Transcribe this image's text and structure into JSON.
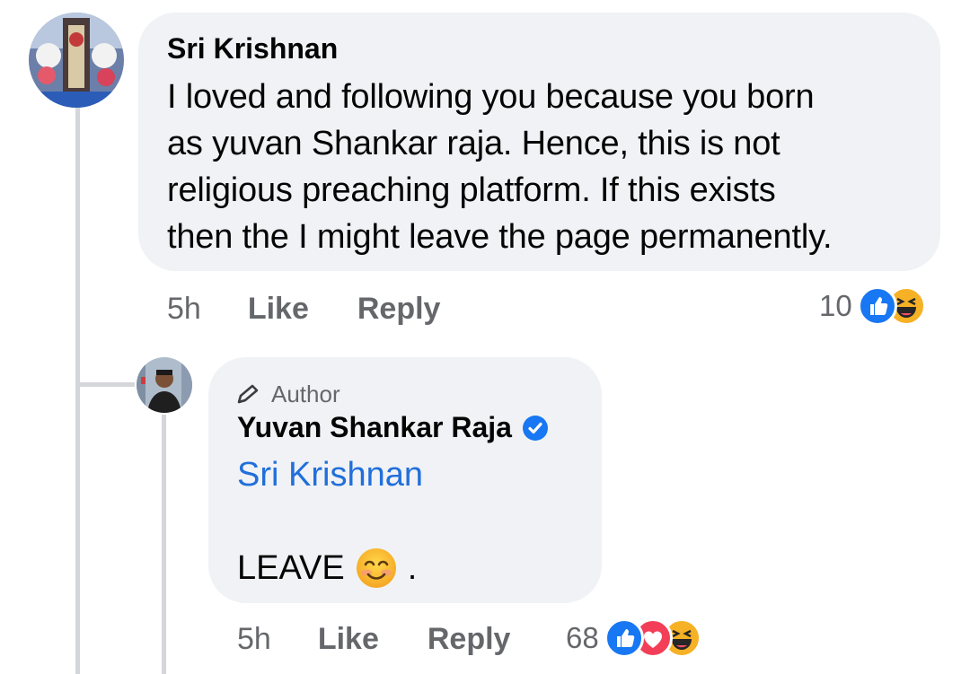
{
  "comment": {
    "author": "Sri Krishnan",
    "text_lines": [
      "I loved and following you because you born",
      "as yuvan Shankar raja. Hence, this is not",
      "religious preaching platform. If this exists",
      "then the I might leave the page permanently."
    ],
    "time": "5h",
    "like_label": "Like",
    "reply_label": "Reply",
    "reaction_count": "10",
    "reactions": [
      "like-icon",
      "haha-icon"
    ]
  },
  "reply": {
    "badge_label": "Author",
    "author": "Yuvan Shankar Raja",
    "verified": true,
    "mention": "Sri Krishnan",
    "text": "LEAVE",
    "text_suffix": ".",
    "emoji": "smiling-face-icon",
    "time": "5h",
    "like_label": "Like",
    "reply_label": "Reply",
    "reaction_count": "68",
    "reactions": [
      "like-icon",
      "love-icon",
      "haha-icon"
    ]
  },
  "colors": {
    "bubble": "#f0f2f5",
    "link": "#216fdb",
    "meta": "#65676b",
    "like": "#1877f2",
    "love": "#f33e58",
    "haha": "#f7b125"
  }
}
